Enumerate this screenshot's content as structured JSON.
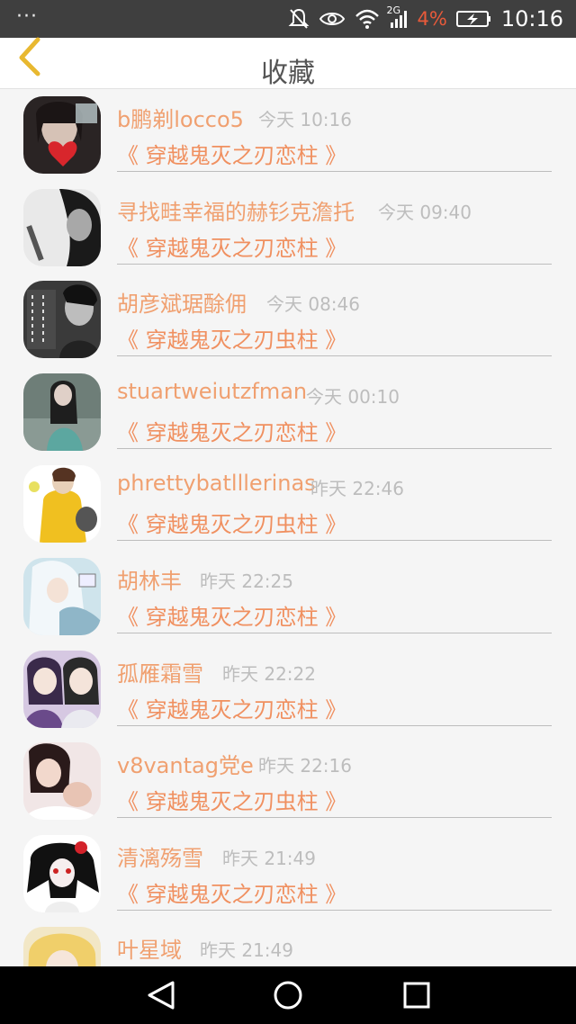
{
  "status_bar": {
    "overflow_icon": "···",
    "network_type": "2G",
    "battery_percent": "4%",
    "time": "10:16",
    "icons": [
      "mute-icon",
      "eye-icon",
      "wifi-icon",
      "signal-icon",
      "battery-charging-icon"
    ],
    "battery_color": "#e85a3a"
  },
  "header": {
    "title": "收藏",
    "back_icon": "chevron-left-icon",
    "back_color": "#e8b830"
  },
  "accent": {
    "name_color": "#f0a070",
    "title_color": "#f09060",
    "time_color": "#bdbdbd"
  },
  "favorites": [
    {
      "name": "b鹏剃locco5",
      "time": "今天 10:16",
      "title": "《 穿越鬼灭之刃恋柱 》",
      "avatar": "girl-heart"
    },
    {
      "name": "寻找畦幸福的赫钐克澹托",
      "time": "今天 09:40",
      "title": "《 穿越鬼灭之刃恋柱 》",
      "avatar": "bw-portrait"
    },
    {
      "name": "胡彦斌琚酴佣",
      "time": "今天 08:46",
      "title": "《 穿越鬼灭之刃虫柱 》",
      "avatar": "text-boy"
    },
    {
      "name": "stuartweiutzfman",
      "time": "今天 00:10",
      "title": "《 穿越鬼灭之刃恋柱 》",
      "avatar": "teal-girl"
    },
    {
      "name": "phrettybatlllerinas",
      "time": "昨天 22:46",
      "title": "《 穿越鬼灭之刃虫柱 》",
      "avatar": "yellow-coat"
    },
    {
      "name": "胡林丰",
      "time": "昨天 22:25",
      "title": "《 穿越鬼灭之刃恋柱 》",
      "avatar": "anime-white"
    },
    {
      "name": "孤雁霜雪",
      "time": "昨天 22:22",
      "title": "《 穿越鬼灭之刃恋柱 》",
      "avatar": "anime-pair"
    },
    {
      "name": "v8vantag党e",
      "time": "昨天 22:16",
      "title": "《 穿越鬼灭之刃虫柱 》",
      "avatar": "couple"
    },
    {
      "name": "清漓殇雪",
      "time": "昨天 21:49",
      "title": "《 穿越鬼灭之刃恋柱 》",
      "avatar": "anime-dark"
    },
    {
      "name": "叶星域",
      "time": "昨天 21:49",
      "title": "",
      "avatar": "anime-blonde"
    }
  ],
  "nav_bar": {
    "buttons": [
      "back-triangle-icon",
      "home-circle-icon",
      "recents-square-icon"
    ]
  }
}
